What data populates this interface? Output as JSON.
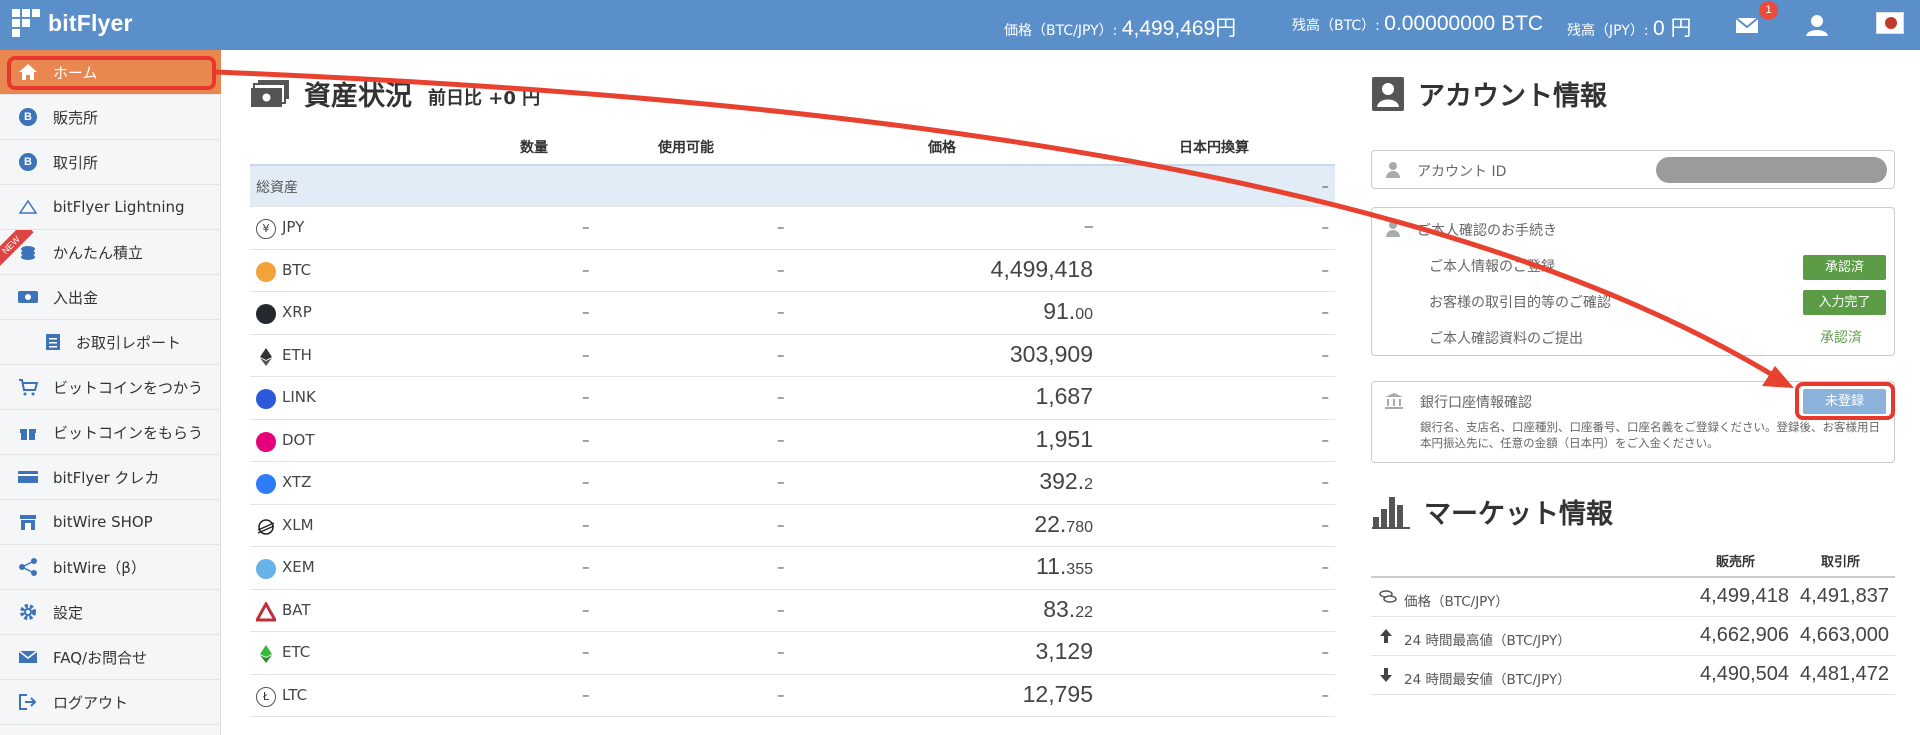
{
  "header": {
    "logo": "bitFlyer",
    "price_label": "価格（BTC/JPY）:",
    "price_value": "4,499,469円",
    "balance_btc_label": "残高（BTC）:",
    "balance_btc_value": "0.00000000 BTC",
    "balance_jpy_label": "残高（JPY）:",
    "balance_jpy_value": "0 円",
    "notification_count": "1"
  },
  "sidebar": {
    "items": [
      {
        "label": "ホーム",
        "icon": "home-icon"
      },
      {
        "label": "販売所",
        "icon": "bitcoin-icon"
      },
      {
        "label": "取引所",
        "icon": "bitcoin-icon"
      },
      {
        "label": "bitFlyer Lightning",
        "icon": "lightning-icon"
      },
      {
        "label": "かんたん積立",
        "icon": "coin-stack-icon",
        "badge": "NEW"
      },
      {
        "label": "入出金",
        "icon": "cash-icon"
      },
      {
        "label": "お取引レポート",
        "icon": "report-icon"
      },
      {
        "label": "ビットコインをつかう",
        "icon": "cart-icon"
      },
      {
        "label": "ビットコインをもらう",
        "icon": "gift-icon"
      },
      {
        "label": "bitFlyer クレカ",
        "icon": "credit-card-icon"
      },
      {
        "label": "bitWire SHOP",
        "icon": "shop-icon"
      },
      {
        "label": "bitWire（β）",
        "icon": "share-icon"
      },
      {
        "label": "設定",
        "icon": "gear-icon"
      },
      {
        "label": "FAQ/お問合せ",
        "icon": "mail-icon"
      },
      {
        "label": "ログアウト",
        "icon": "logout-icon"
      }
    ]
  },
  "assets": {
    "title": "資産状況",
    "diff": "前日比 +0 円",
    "columns": [
      "数量",
      "使用可能",
      "価格",
      "日本円換算"
    ],
    "total_label": "総資産",
    "total_value": "–",
    "rows": [
      {
        "symbol": "JPY",
        "qty": "–",
        "avail": "–",
        "price": "–",
        "price_dec": "",
        "jpy": "–",
        "color": "#ffffff"
      },
      {
        "symbol": "BTC",
        "qty": "–",
        "avail": "–",
        "price": "4,499,418",
        "price_dec": "",
        "jpy": "–",
        "color": "#f2a33a"
      },
      {
        "symbol": "XRP",
        "qty": "–",
        "avail": "–",
        "price": "91.",
        "price_dec": "00",
        "jpy": "–",
        "color": "#23292f"
      },
      {
        "symbol": "ETH",
        "qty": "–",
        "avail": "–",
        "price": "303,909",
        "price_dec": "",
        "jpy": "–",
        "color": "#3c3c3d"
      },
      {
        "symbol": "LINK",
        "qty": "–",
        "avail": "–",
        "price": "1,687",
        "price_dec": "",
        "jpy": "–",
        "color": "#2a5ada"
      },
      {
        "symbol": "DOT",
        "qty": "–",
        "avail": "–",
        "price": "1,951",
        "price_dec": "",
        "jpy": "–",
        "color": "#e6007a"
      },
      {
        "symbol": "XTZ",
        "qty": "–",
        "avail": "–",
        "price": "392.",
        "price_dec": "2",
        "jpy": "–",
        "color": "#2c7df7"
      },
      {
        "symbol": "XLM",
        "qty": "–",
        "avail": "–",
        "price": "22.",
        "price_dec": "780",
        "jpy": "–",
        "color": "#222222"
      },
      {
        "symbol": "XEM",
        "qty": "–",
        "avail": "–",
        "price": "11.",
        "price_dec": "355",
        "jpy": "–",
        "color": "#67b2e8"
      },
      {
        "symbol": "BAT",
        "qty": "–",
        "avail": "–",
        "price": "83.",
        "price_dec": "22",
        "jpy": "–",
        "color": "#ff5000"
      },
      {
        "symbol": "ETC",
        "qty": "–",
        "avail": "–",
        "price": "3,129",
        "price_dec": "",
        "jpy": "–",
        "color": "#3ab83a"
      },
      {
        "symbol": "LTC",
        "qty": "–",
        "avail": "–",
        "price": "12,795",
        "price_dec": "",
        "jpy": "–",
        "color": "#bfbbbb"
      }
    ]
  },
  "account": {
    "title": "アカウント情報",
    "account_id_label": "アカウント ID",
    "identity_title": "ご本人確認のお手続き",
    "identity_items": [
      {
        "label": "ご本人情報のご登録",
        "status": "承認済"
      },
      {
        "label": "お客様の取引目的等のご確認",
        "status": "入力完了"
      },
      {
        "label": "ご本人確認資料のご提出",
        "status": "承認済"
      }
    ],
    "bank_title": "銀行口座情報確認",
    "bank_status": "未登録",
    "bank_desc": "銀行名、支店名、口座種別、口座番号、口座名義をご登録ください。登録後、お客様用日本円振込先に、任意の金額（日本円）をご入金ください。"
  },
  "market": {
    "title": "マーケット情報",
    "col_sales": "販売所",
    "col_exchange": "取引所",
    "rows": [
      {
        "label": "価格（BTC/JPY）",
        "sales": "4,499,418",
        "exchange": "4,491,837",
        "icon": "coins-icon"
      },
      {
        "label": "24 時間最高値（BTC/JPY）",
        "sales": "4,662,906",
        "exchange": "4,663,000",
        "icon": "arrow-up-icon"
      },
      {
        "label": "24 時間最安値（BTC/JPY）",
        "sales": "4,490,504",
        "exchange": "4,481,472",
        "icon": "arrow-down-icon"
      }
    ]
  },
  "colors": {
    "header_bg": "#5b8fc9",
    "active_nav": "#e8874f",
    "annotation": "#e8382b",
    "approved_green": "#5d9c47",
    "unregistered_blue": "#8bb2da"
  }
}
